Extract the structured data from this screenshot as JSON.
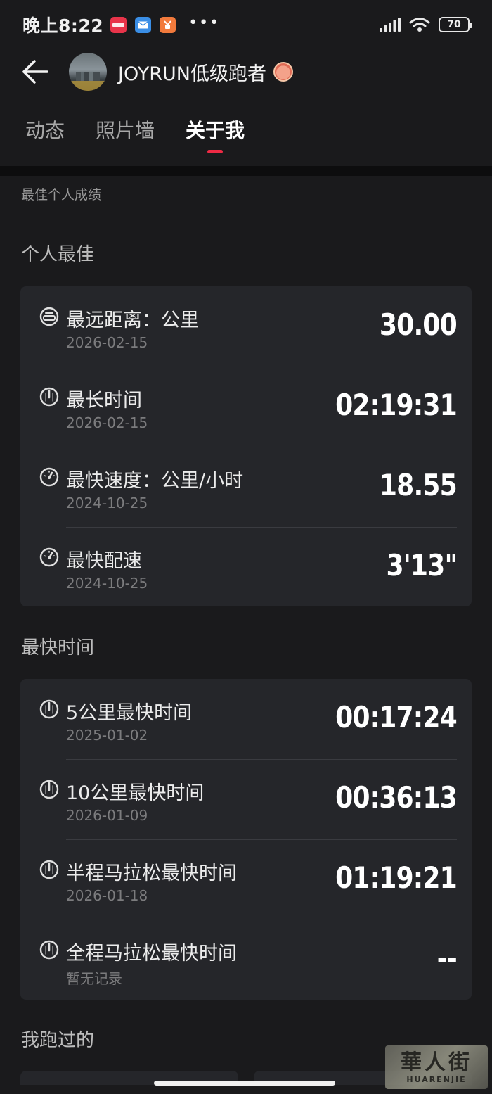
{
  "status_bar": {
    "time": "晚上8:22",
    "apps": [
      {
        "name": "app-red-icon",
        "color": "#e8344a"
      },
      {
        "name": "app-mail-icon",
        "color": "#3a8ee6"
      },
      {
        "name": "app-orange-icon",
        "color": "#f27a3c"
      }
    ],
    "overflow": "•••",
    "battery": "70"
  },
  "header": {
    "username": "JOYRUN低级跑者"
  },
  "tabs": [
    {
      "label": "动态",
      "active": false
    },
    {
      "label": "照片墙",
      "active": false
    },
    {
      "label": "关于我",
      "active": true
    }
  ],
  "crumb": "最佳个人成绩",
  "personal_best": {
    "title": "个人最佳",
    "rows": [
      {
        "icon": "distance-gauge-icon",
        "label": "最远距离：公里",
        "date": "2026-02-15",
        "value": "30.00"
      },
      {
        "icon": "stopwatch-icon",
        "label": "最长时间",
        "date": "2026-02-15",
        "value": "02:19:31"
      },
      {
        "icon": "speedometer-icon",
        "label": "最快速度：公里/小时",
        "date": "2024-10-25",
        "value": "18.55"
      },
      {
        "icon": "speedometer-icon",
        "label": "最快配速",
        "date": "2024-10-25",
        "value": "3'13\""
      }
    ]
  },
  "fastest_time": {
    "title": "最快时间",
    "rows": [
      {
        "icon": "stopwatch-icon",
        "label": "5公里最快时间",
        "date": "2025-01-02",
        "value": "00:17:24"
      },
      {
        "icon": "stopwatch-icon",
        "label": "10公里最快时间",
        "date": "2026-01-09",
        "value": "00:36:13"
      },
      {
        "icon": "stopwatch-icon",
        "label": "半程马拉松最快时间",
        "date": "2026-01-18",
        "value": "01:19:21"
      },
      {
        "icon": "stopwatch-icon",
        "label": "全程马拉松最快时间",
        "date": "暂无记录",
        "value": "--"
      }
    ]
  },
  "ran_section": {
    "title": "我跑过的"
  },
  "watermark": {
    "main": "華人街",
    "sub": "HUARENJIE"
  },
  "colors": {
    "background": "#1a1a1c",
    "card": "#25262a",
    "accent": "#ee2a44"
  }
}
